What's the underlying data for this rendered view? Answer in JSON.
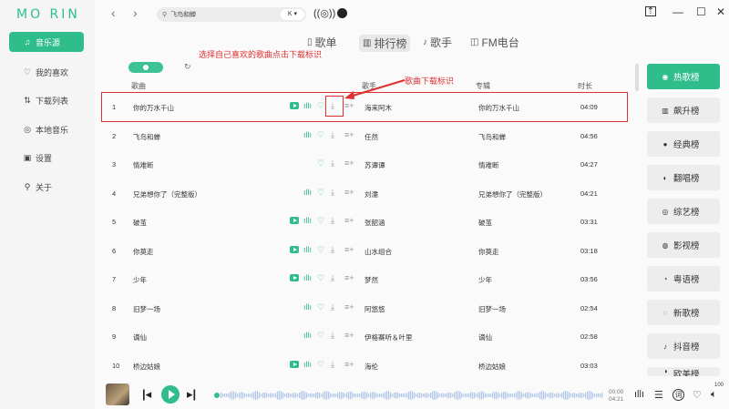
{
  "app": {
    "logo": "MO RIN"
  },
  "sidebar": {
    "items": [
      {
        "label": "音乐源",
        "icon": "music-note-icon",
        "glyph": "♫",
        "active": true
      },
      {
        "label": "我的喜欢",
        "icon": "heart-icon",
        "glyph": "♡",
        "active": false
      },
      {
        "label": "下载列表",
        "icon": "sort-download-icon",
        "glyph": "⇅",
        "active": false
      },
      {
        "label": "本地音乐",
        "icon": "disc-icon",
        "glyph": "◎",
        "active": false
      },
      {
        "label": "设置",
        "icon": "settings-icon",
        "glyph": "▣",
        "active": false
      },
      {
        "label": "关于",
        "icon": "location-pin-icon",
        "glyph": "⚲",
        "active": false
      }
    ]
  },
  "topbar": {
    "search_value": "飞鸟和蝉",
    "source_chip": "K ▾"
  },
  "tabs": [
    {
      "label": "歌单",
      "glyph": "▯",
      "icon": "playlist-icon",
      "active": false
    },
    {
      "label": "排行榜",
      "glyph": "▥",
      "icon": "chart-bars-icon",
      "active": true
    },
    {
      "label": "歌手",
      "glyph": "♪",
      "icon": "singer-icon",
      "active": false
    },
    {
      "label": "FM电台",
      "glyph": "◫",
      "icon": "radio-icon",
      "active": false
    }
  ],
  "annotations": {
    "instruction": "选择自己喜欢的歌曲点击下载标识",
    "download_label": "歌曲下载标识"
  },
  "columns": {
    "song": "歌曲",
    "artist": "歌手",
    "album": "专辑",
    "duration": "时长"
  },
  "songs": [
    {
      "num": "1",
      "title": "你的万水千山",
      "artist": "海来阿木",
      "album": "你的万水千山",
      "duration": "04:09",
      "mv": true,
      "wave": true
    },
    {
      "num": "2",
      "title": "飞鸟和蝉",
      "artist": "任然",
      "album": "飞鸟和蝉",
      "duration": "04:56",
      "mv": false,
      "wave": true
    },
    {
      "num": "3",
      "title": "情难断",
      "artist": "苏谭谭",
      "album": "情难断",
      "duration": "04:27",
      "mv": false,
      "wave": false
    },
    {
      "num": "4",
      "title": "兄弟想你了（完整版）",
      "artist": "刘濡",
      "album": "兄弟想你了（完整版）",
      "duration": "04:21",
      "mv": false,
      "wave": true
    },
    {
      "num": "5",
      "title": "破茧",
      "artist": "张韶涵",
      "album": "破茧",
      "duration": "03:31",
      "mv": true,
      "wave": true
    },
    {
      "num": "6",
      "title": "你莫走",
      "artist": "山水组合",
      "album": "你莫走",
      "duration": "03:18",
      "mv": true,
      "wave": true
    },
    {
      "num": "7",
      "title": "少年",
      "artist": "梦然",
      "album": "少年",
      "duration": "03:56",
      "mv": true,
      "wave": true
    },
    {
      "num": "8",
      "title": "旧梦一场",
      "artist": "阿悠悠",
      "album": "旧梦一场",
      "duration": "02:54",
      "mv": false,
      "wave": true
    },
    {
      "num": "9",
      "title": "谪仙",
      "artist": "伊格赛听＆叶里",
      "album": "谪仙",
      "duration": "02:58",
      "mv": false,
      "wave": true
    },
    {
      "num": "10",
      "title": "桥边姑娘",
      "artist": "海伦",
      "album": "桥边姑娘",
      "duration": "03:03",
      "mv": true,
      "wave": true
    }
  ],
  "rankings": [
    {
      "label": "热歌榜",
      "glyph": "◉",
      "icon": "hot-icon",
      "active": true
    },
    {
      "label": "飙升榜",
      "glyph": "▥",
      "icon": "rising-icon",
      "active": false
    },
    {
      "label": "经典榜",
      "glyph": "●",
      "icon": "classic-icon",
      "active": false
    },
    {
      "label": "翻唱榜",
      "glyph": "◐",
      "icon": "cover-icon",
      "active": false
    },
    {
      "label": "综艺榜",
      "glyph": "◎",
      "icon": "variety-icon",
      "active": false
    },
    {
      "label": "影视榜",
      "glyph": "◍",
      "icon": "film-icon",
      "active": false
    },
    {
      "label": "粤语榜",
      "glyph": "◔",
      "icon": "cantonese-icon",
      "active": false
    },
    {
      "label": "新歌榜",
      "glyph": "◌",
      "icon": "new-song-icon",
      "active": false
    },
    {
      "label": "抖音榜",
      "glyph": "♪",
      "icon": "douyin-icon",
      "active": false
    },
    {
      "label": "欧美榜",
      "glyph": "◑",
      "icon": "western-icon",
      "active": false
    }
  ],
  "player": {
    "current_time": "00:00",
    "total_time": "04:21",
    "volume": "100",
    "lyrics_glyph": "词"
  },
  "colors": {
    "accent": "#2fbd8c",
    "annotation": "#e03030"
  }
}
